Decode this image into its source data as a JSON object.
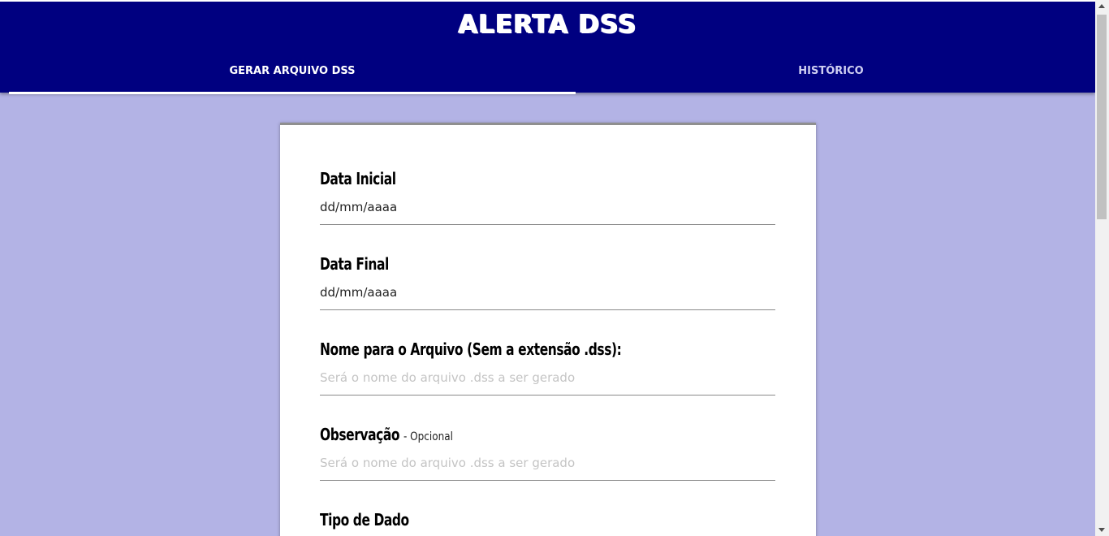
{
  "header": {
    "title": "ALERTA DSS",
    "tabs": [
      {
        "label": "GERAR ARQUIVO DSS",
        "active": true
      },
      {
        "label": "HISTÓRICO",
        "active": false
      }
    ]
  },
  "form": {
    "data_inicial": {
      "label": "Data Inicial",
      "value": "dd/mm/aaaa"
    },
    "data_final": {
      "label": "Data Final",
      "value": "dd/mm/aaaa"
    },
    "nome_arquivo": {
      "label": "Nome para o Arquivo (Sem a extensão .dss):",
      "placeholder": "Será o nome do arquivo .dss a ser gerado"
    },
    "observacao": {
      "label": "Observação",
      "optional_note": "- Opcional",
      "placeholder": "Será o nome do arquivo .dss a ser gerado"
    },
    "tipo_dado": {
      "label": "Tipo de Dado"
    }
  },
  "colors": {
    "header_bg": "#000080",
    "page_bg": "#b3b3e5",
    "card_bg": "#ffffff"
  }
}
